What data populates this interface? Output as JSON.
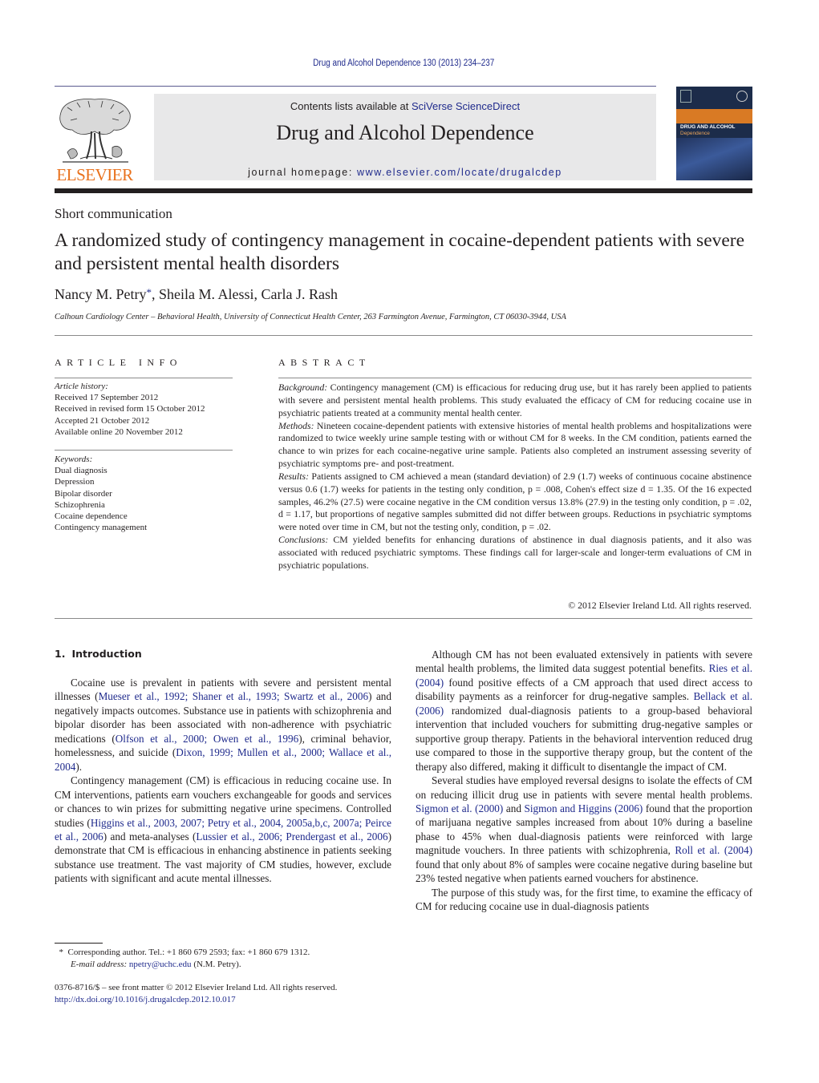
{
  "running_head": "Drug and Alcohol Dependence 130 (2013) 234–237",
  "publisher": {
    "logo_wordmark": "ELSEVIER",
    "brand_color": "#e9711c",
    "link_color": "#1f2a8c"
  },
  "masthead": {
    "contents_prefix": "Contents lists available at ",
    "contents_link": "SciVerse ScienceDirect",
    "journal_title": "Drug and Alcohol Dependence",
    "homepage_prefix": "journal homepage: ",
    "homepage_link": "www.elsevier.com/locate/drugalcdep"
  },
  "cover": {
    "title_line1": "DRUG AND ALCOHOL",
    "title_line2": "Dependence"
  },
  "article": {
    "type": "Short communication",
    "title": "A randomized study of contingency management in cocaine-dependent patients with severe and persistent mental health disorders",
    "authors": [
      {
        "name": "Nancy M. Petry",
        "marker": "*"
      },
      {
        "name": "Sheila M. Alessi",
        "marker": ""
      },
      {
        "name": "Carla J. Rash",
        "marker": ""
      }
    ],
    "affiliation": "Calhoun Cardiology Center – Behavioral Health, University of Connecticut Health Center, 263 Farmington Avenue, Farmington, CT 06030-3944, USA"
  },
  "article_info": {
    "heading": "ARTICLE INFO",
    "history_label": "Article history:",
    "history": [
      "Received 17 September 2012",
      "Received in revised form 15 October 2012",
      "Accepted 21 October 2012",
      "Available online 20 November 2012"
    ],
    "keywords_label": "Keywords:",
    "keywords": [
      "Dual diagnosis",
      "Depression",
      "Bipolar disorder",
      "Schizophrenia",
      "Cocaine dependence",
      "Contingency management"
    ]
  },
  "abstract": {
    "heading": "ABSTRACT",
    "sections": [
      {
        "label": "Background:",
        "text": " Contingency management (CM) is efficacious for reducing drug use, but it has rarely been applied to patients with severe and persistent mental health problems. This study evaluated the efficacy of CM for reducing cocaine use in psychiatric patients treated at a community mental health center."
      },
      {
        "label": "Methods:",
        "text": " Nineteen cocaine-dependent patients with extensive histories of mental health problems and hospitalizations were randomized to twice weekly urine sample testing with or without CM for 8 weeks. In the CM condition, patients earned the chance to win prizes for each cocaine-negative urine sample. Patients also completed an instrument assessing severity of psychiatric symptoms pre- and post-treatment."
      },
      {
        "label": "Results:",
        "text": " Patients assigned to CM achieved a mean (standard deviation) of 2.9 (1.7) weeks of continuous cocaine abstinence versus 0.6 (1.7) weeks for patients in the testing only condition, p = .008, Cohen's effect size d = 1.35. Of the 16 expected samples, 46.2% (27.5) were cocaine negative in the CM condition versus 13.8% (27.9) in the testing only condition, p = .02, d = 1.17, but proportions of negative samples submitted did not differ between groups. Reductions in psychiatric symptoms were noted over time in CM, but not the testing only, condition, p = .02."
      },
      {
        "label": "Conclusions:",
        "text": " CM yielded benefits for enhancing durations of abstinence in dual diagnosis patients, and it also was associated with reduced psychiatric symptoms. These findings call for larger-scale and longer-term evaluations of CM in psychiatric populations."
      }
    ],
    "copyright": "© 2012 Elsevier Ireland Ltd. All rights reserved."
  },
  "body": {
    "intro_number": "1.",
    "intro_title": "Introduction",
    "left_paragraphs": [
      [
        {
          "t": "Cocaine use is prevalent in patients with severe and persistent mental illnesses ("
        },
        {
          "t": "Mueser et al., 1992; Shaner et al., 1993; Swartz et al., 2006",
          "link": true
        },
        {
          "t": ") and negatively impacts outcomes. Substance use in patients with schizophrenia and bipolar disorder has been associated with non-adherence with psychiatric medications ("
        },
        {
          "t": "Olfson et al., 2000; Owen et al., 1996",
          "link": true
        },
        {
          "t": "), criminal behavior, homelessness, and suicide ("
        },
        {
          "t": "Dixon, 1999; Mullen et al., 2000; Wallace et al., 2004",
          "link": true
        },
        {
          "t": ")."
        }
      ],
      [
        {
          "t": "Contingency management (CM) is efficacious in reducing cocaine use. In CM interventions, patients earn vouchers exchangeable for goods and services or chances to win prizes for submitting negative urine specimens. Controlled studies ("
        },
        {
          "t": "Higgins et al., 2003, 2007; Petry et al., 2004, 2005a,b,c, 2007a; Peirce et al., 2006",
          "link": true
        },
        {
          "t": ") and meta-analyses ("
        },
        {
          "t": "Lussier et al., 2006; Prendergast et al., 2006",
          "link": true
        },
        {
          "t": ") demonstrate that CM is efficacious in enhancing abstinence in patients seeking substance use treatment. The vast majority of CM studies, however, exclude patients with significant and acute mental illnesses."
        }
      ]
    ],
    "right_paragraphs": [
      [
        {
          "t": "Although CM has not been evaluated extensively in patients with severe mental health problems, the limited data suggest potential benefits. "
        },
        {
          "t": "Ries et al. (2004)",
          "link": true
        },
        {
          "t": " found positive effects of a CM approach that used direct access to disability payments as a reinforcer for drug-negative samples. "
        },
        {
          "t": "Bellack et al. (2006)",
          "link": true
        },
        {
          "t": " randomized dual-diagnosis patients to a group-based behavioral intervention that included vouchers for submitting drug-negative samples or supportive group therapy. Patients in the behavioral intervention reduced drug use compared to those in the supportive therapy group, but the content of the therapy also differed, making it difficult to disentangle the impact of CM."
        }
      ],
      [
        {
          "t": "Several studies have employed reversal designs to isolate the effects of CM on reducing illicit drug use in patients with severe mental health problems. "
        },
        {
          "t": "Sigmon et al. (2000)",
          "link": true
        },
        {
          "t": " and "
        },
        {
          "t": "Sigmon and Higgins (2006)",
          "link": true
        },
        {
          "t": " found that the proportion of marijuana negative samples increased from about 10% during a baseline phase to 45% when dual-diagnosis patients were reinforced with large magnitude vouchers. In three patients with schizophrenia, "
        },
        {
          "t": "Roll et al. (2004)",
          "link": true
        },
        {
          "t": " found that only about 8% of samples were cocaine negative during baseline but 23% tested negative when patients earned vouchers for abstinence."
        }
      ],
      [
        {
          "t": "The purpose of this study was, for the first time, to examine the efficacy of CM for reducing cocaine use in dual-diagnosis patients"
        }
      ]
    ]
  },
  "footnote": {
    "marker": "*",
    "text": "Corresponding author. Tel.: +1 860 679 2593; fax: +1 860 679 1312.",
    "email_label": "E-mail address:",
    "email": "npetry@uchc.edu",
    "email_suffix": " (N.M. Petry)."
  },
  "front_matter": {
    "issn_line": "0376-8716/$ – see front matter © 2012 Elsevier Ireland Ltd. All rights reserved.",
    "doi_link": "http://dx.doi.org/10.1016/j.drugalcdep.2012.10.017"
  }
}
